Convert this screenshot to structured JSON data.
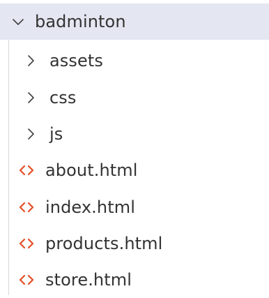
{
  "explorer": {
    "root": {
      "label": "badminton",
      "icon": "chevron-down-icon",
      "expanded": true
    },
    "folders": [
      {
        "label": "assets",
        "icon": "chevron-right-icon",
        "expanded": false
      },
      {
        "label": "css",
        "icon": "chevron-right-icon",
        "expanded": false
      },
      {
        "label": "js",
        "icon": "chevron-right-icon",
        "expanded": false
      }
    ],
    "files": [
      {
        "label": "about.html",
        "icon": "html-file-icon"
      },
      {
        "label": "index.html",
        "icon": "html-file-icon"
      },
      {
        "label": "products.html",
        "icon": "html-file-icon"
      },
      {
        "label": "store.html",
        "icon": "html-file-icon"
      }
    ]
  },
  "colors": {
    "root_background": "#e4e6f1",
    "text": "#333333",
    "chevron": "#424242",
    "html_icon": "#e44d26",
    "indent_guide": "#d7d7d7"
  }
}
